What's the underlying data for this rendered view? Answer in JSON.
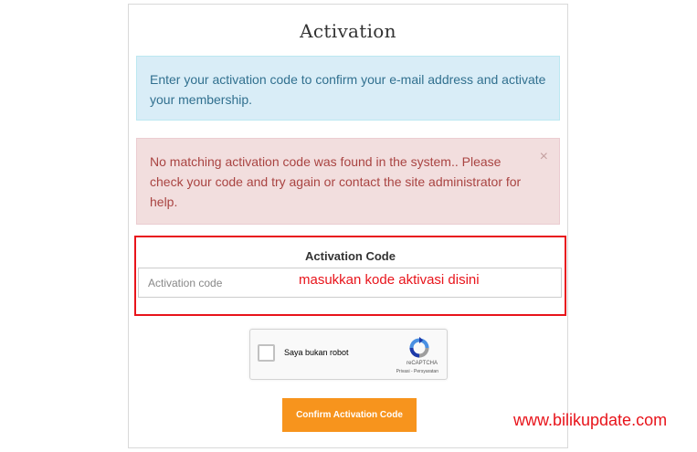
{
  "page": {
    "title": "Activation"
  },
  "alerts": {
    "info_text": "Enter your activation code to confirm your e-mail address and activate your membership.",
    "error_text": "No matching activation code was found in the system.. Please check your code and try again or contact the site administrator for help.",
    "close_symbol": "×"
  },
  "form": {
    "field_label": "Activation Code",
    "code_placeholder": "Activation code",
    "code_value": ""
  },
  "annotation": {
    "text": "masukkan kode aktivasi disini",
    "color": "#e8141b"
  },
  "captcha": {
    "label": "Saya bukan robot",
    "brand": "reCAPTCHA",
    "links": "Privasi - Persyaratan",
    "logo_icon": "recaptcha-logo-icon"
  },
  "actions": {
    "confirm_label": "Confirm Activation Code",
    "confirm_color": "#f7941d"
  },
  "watermark": {
    "text": "www.bilikupdate.com"
  }
}
